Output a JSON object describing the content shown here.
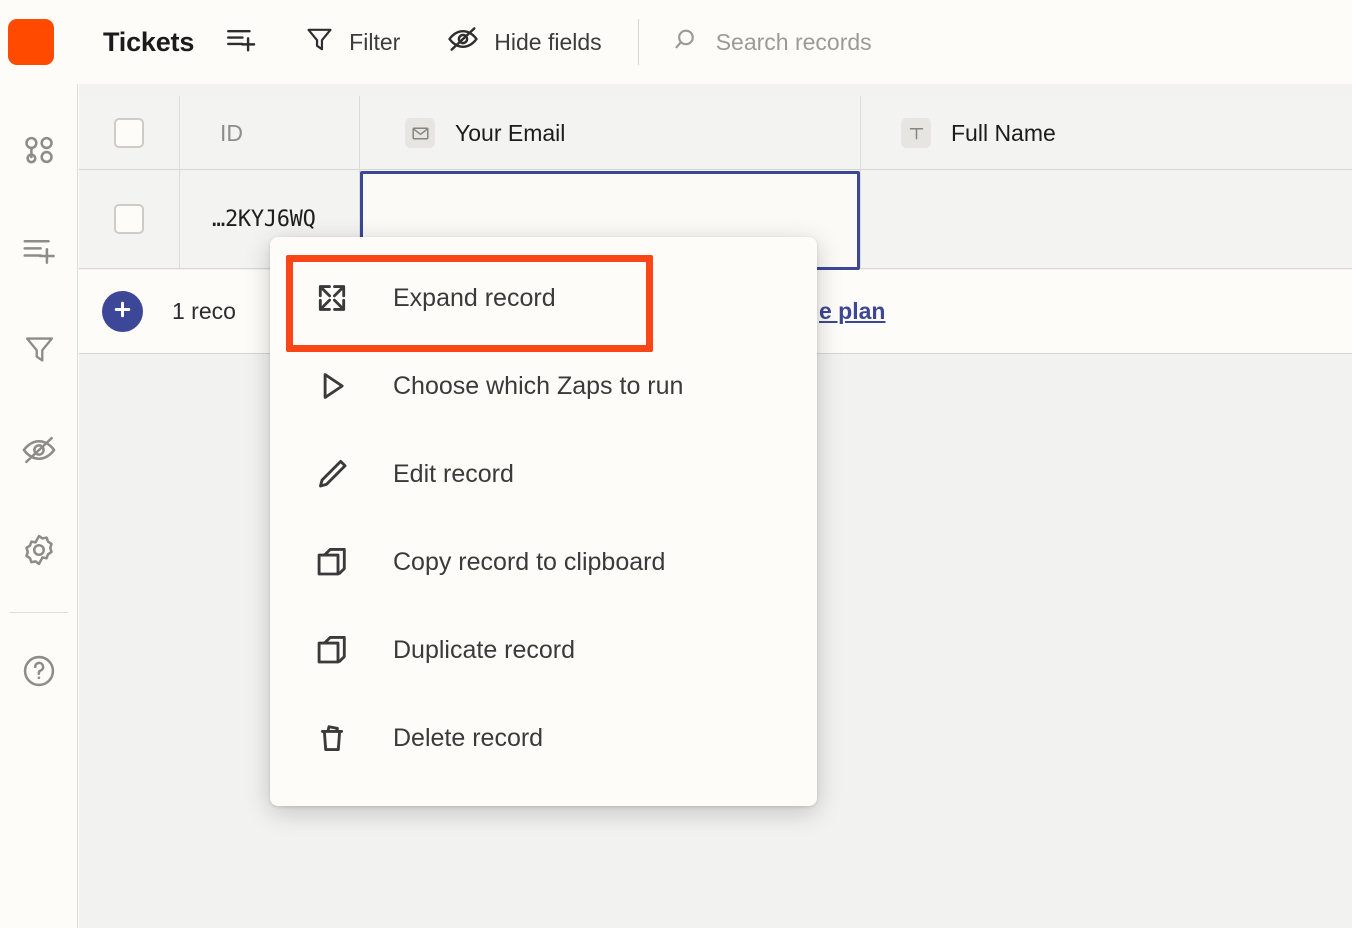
{
  "app": {
    "title": "Tickets",
    "brand_color": "#ff4a00",
    "accent_color": "#3d4797",
    "highlight_color": "#fa4616"
  },
  "toolbar": {
    "logo_name": "app-logo",
    "items": [
      {
        "id": "add-row",
        "label": "",
        "icon": "add-row-icon"
      },
      {
        "id": "filter",
        "label": "Filter",
        "icon": "filter-icon"
      },
      {
        "id": "hide-fields",
        "label": "Hide fields",
        "icon": "eye-slash-icon"
      }
    ],
    "search": {
      "placeholder": "Search records",
      "icon": "search-icon",
      "value": ""
    }
  },
  "sidebar": {
    "items": [
      {
        "id": "apps",
        "icon": "apps-grid-icon"
      },
      {
        "id": "add-row",
        "icon": "add-row-icon"
      },
      {
        "id": "filter",
        "icon": "filter-icon"
      },
      {
        "id": "hide-fields",
        "icon": "eye-slash-icon"
      },
      {
        "id": "settings",
        "icon": "gear-icon"
      },
      {
        "id": "help",
        "icon": "question-circle-icon"
      }
    ]
  },
  "grid": {
    "columns": [
      {
        "id": "select",
        "label": "",
        "field_icon": ""
      },
      {
        "id": "id",
        "label": "ID",
        "field_icon": ""
      },
      {
        "id": "your_email",
        "label": "Your Email",
        "field_icon": "envelope-icon"
      },
      {
        "id": "full_name",
        "label": "Full Name",
        "field_icon": "text-t-icon"
      }
    ],
    "rows": [
      {
        "id": "…2KYJ6WQ",
        "your_email": "",
        "full_name": ""
      }
    ],
    "selected_cell": {
      "row": 0,
      "column": "your_email"
    },
    "footer": {
      "add_icon": "plus-icon",
      "record_count": "1 reco",
      "plan_link": "e plan"
    }
  },
  "context_menu": {
    "items": [
      {
        "id": "expand-record",
        "label": "Expand record",
        "icon": "expand-arrows-icon",
        "highlighted": true
      },
      {
        "id": "choose-zaps",
        "label": "Choose which Zaps to run",
        "icon": "play-triangle-icon",
        "highlighted": false
      },
      {
        "id": "edit-record",
        "label": "Edit record",
        "icon": "pencil-icon",
        "highlighted": false
      },
      {
        "id": "copy-record",
        "label": "Copy record to clipboard",
        "icon": "copy-icon",
        "highlighted": false
      },
      {
        "id": "duplicate-record",
        "label": "Duplicate record",
        "icon": "duplicate-icon",
        "highlighted": false
      },
      {
        "id": "delete-record",
        "label": "Delete record",
        "icon": "trash-icon",
        "highlighted": false
      }
    ]
  }
}
